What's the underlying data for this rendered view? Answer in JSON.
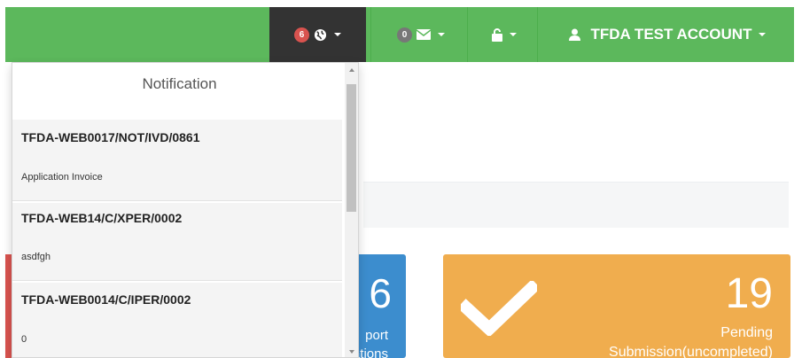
{
  "navbar": {
    "notifications": {
      "count": "6",
      "icon": "globe-icon"
    },
    "messages": {
      "count": "0",
      "icon": "envelope-icon"
    },
    "lock": {
      "icon": "unlock-icon"
    },
    "account": {
      "icon": "user-icon",
      "label": "TFDA TEST ACCOUNT"
    },
    "colors": {
      "bar": "#5cb85c",
      "active": "#333333",
      "badge_red": "#d9534f",
      "badge_grey": "#777777"
    }
  },
  "notification_dropdown": {
    "header": "Notification",
    "items": [
      {
        "title": "TFDA-WEB0017/NOT/IVD/0861",
        "body": "Application Invoice"
      },
      {
        "title": "TFDA-WEB14/C/XPER/0002",
        "body": "asdfgh"
      },
      {
        "title": "TFDA-WEB0014/C/IPER/0002",
        "body": "0"
      }
    ]
  },
  "panels": {
    "blue": {
      "count": "6",
      "line1": "port",
      "line2": "ations",
      "color": "#3c8dce"
    },
    "orange": {
      "count": "19",
      "line1": "Pending",
      "line2": "Submission(uncompleted)",
      "icon": "check-icon",
      "color": "#f0ad4e"
    },
    "red": {
      "color": "#d9534f"
    }
  }
}
